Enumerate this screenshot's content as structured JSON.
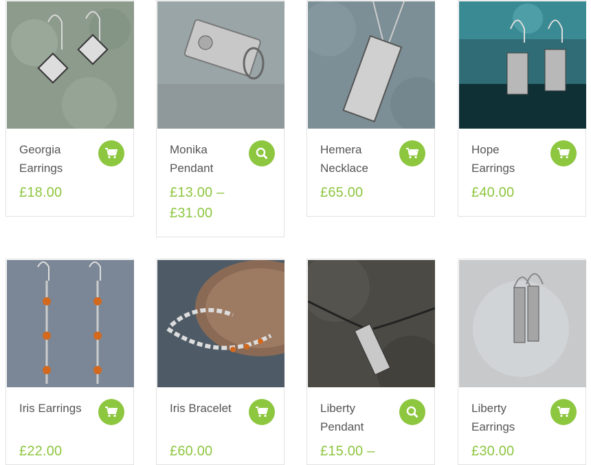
{
  "colors": {
    "accent": "#8dc63f",
    "text": "#555555",
    "border": "#e2e2e2"
  },
  "products": [
    {
      "name": "Georgia Earrings",
      "price": "£18.00",
      "action": "add-to-cart",
      "action_icon": "cart-icon"
    },
    {
      "name": "Monika Pendant",
      "price": "£13.00 – £31.00",
      "action": "select-options",
      "action_icon": "magnifier-icon"
    },
    {
      "name": "Hemera Necklace",
      "price": "£65.00",
      "action": "add-to-cart",
      "action_icon": "cart-icon"
    },
    {
      "name": "Hope Earrings",
      "price": "£40.00",
      "action": "add-to-cart",
      "action_icon": "cart-icon"
    },
    {
      "name": "Iris Earrings",
      "price": "£22.00",
      "action": "add-to-cart",
      "action_icon": "cart-icon"
    },
    {
      "name": "Iris Bracelet",
      "price": "£60.00",
      "action": "add-to-cart",
      "action_icon": "cart-icon"
    },
    {
      "name": "Liberty Pendant",
      "price": "£15.00 –",
      "action": "select-options",
      "action_icon": "magnifier-icon"
    },
    {
      "name": "Liberty Earrings",
      "price": "£30.00",
      "action": "add-to-cart",
      "action_icon": "cart-icon"
    }
  ]
}
